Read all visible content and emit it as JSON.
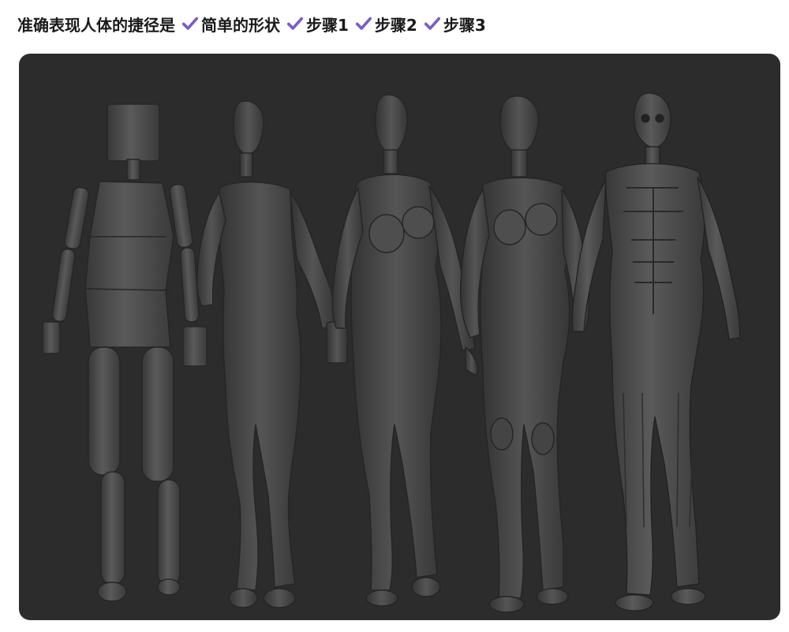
{
  "header": {
    "intro": "准确表现人体的捷径是",
    "steps": [
      "简单的形状",
      "步骤1",
      "步骤2",
      "步骤3"
    ]
  },
  "icons": {
    "check": "check-icon"
  },
  "colors": {
    "check": "#7b5cc9",
    "panel": "#2c2c2c",
    "figure": "#4a4a4a",
    "figure_light": "#6a6a6a",
    "figure_dark": "#303030"
  },
  "figures": [
    "simple-shapes-figure",
    "step1-figure",
    "step2-figure",
    "step3-figure",
    "anatomy-figure"
  ]
}
